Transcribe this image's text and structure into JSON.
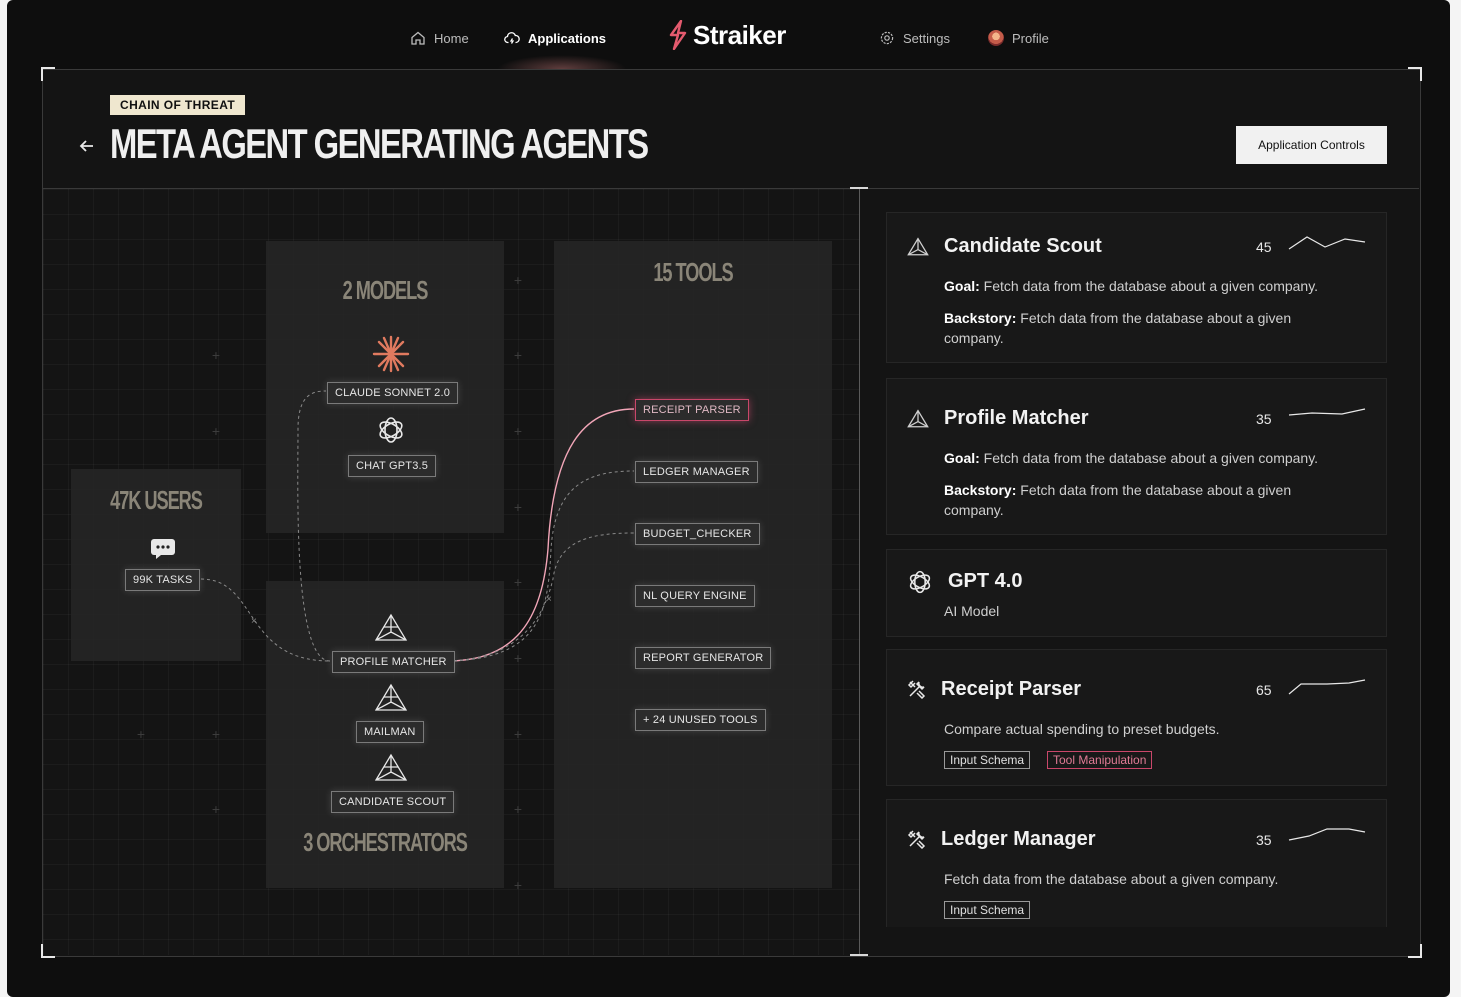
{
  "nav": {
    "home": "Home",
    "applications": "Applications",
    "logo": "Straiker",
    "settings": "Settings",
    "profile": "Profile"
  },
  "header": {
    "badge": "CHAIN OF THREAT",
    "title": "META AGENT GENERATING AGENTS",
    "controls_button": "Application Controls"
  },
  "diagram": {
    "users": {
      "title": "47K USERS",
      "chip": "99K TASKS"
    },
    "models": {
      "title": "2 MODELS",
      "items": [
        "CLAUDE SONNET 2.0",
        "CHAT GPT3.5"
      ]
    },
    "orchestrators": {
      "title": "3 ORCHESTRATORS",
      "items": [
        "PROFILE MATCHER",
        "MAILMAN",
        "CANDIDATE SCOUT"
      ]
    },
    "tools": {
      "title": "15 TOOLS",
      "items": [
        "RECEIPT PARSER",
        "LEDGER MANAGER",
        "BUDGET_CHECKER",
        "NL QUERY ENGINE",
        "REPORT GENERATOR",
        "+ 24 UNUSED TOOLS"
      ]
    }
  },
  "cards": [
    {
      "title": "Candidate Scout",
      "num": "45",
      "goal_label": "Goal:",
      "goal": "Fetch data from the database about a given company.",
      "backstory_label": "Backstory:",
      "backstory": "Fetch data from the database about a given company."
    },
    {
      "title": "Profile Matcher",
      "num": "35",
      "goal_label": "Goal:",
      "goal": "Fetch data from the database about a given company.",
      "backstory_label": "Backstory:",
      "backstory": "Fetch data from the database about a given company."
    },
    {
      "title": "GPT 4.0",
      "subtitle": "AI Model"
    },
    {
      "title": "Receipt Parser",
      "num": "65",
      "desc": "Compare actual spending to preset budgets.",
      "tags": [
        "Input Schema",
        "Tool Manipulation"
      ]
    },
    {
      "title": "Ledger Manager",
      "num": "35",
      "desc": "Fetch data from the database about a given company.",
      "tags": [
        "Input Schema"
      ]
    }
  ],
  "colors": {
    "accent_red": "#c9476a",
    "badge_bg": "#efe7cf",
    "background": "#0e0e0e"
  }
}
